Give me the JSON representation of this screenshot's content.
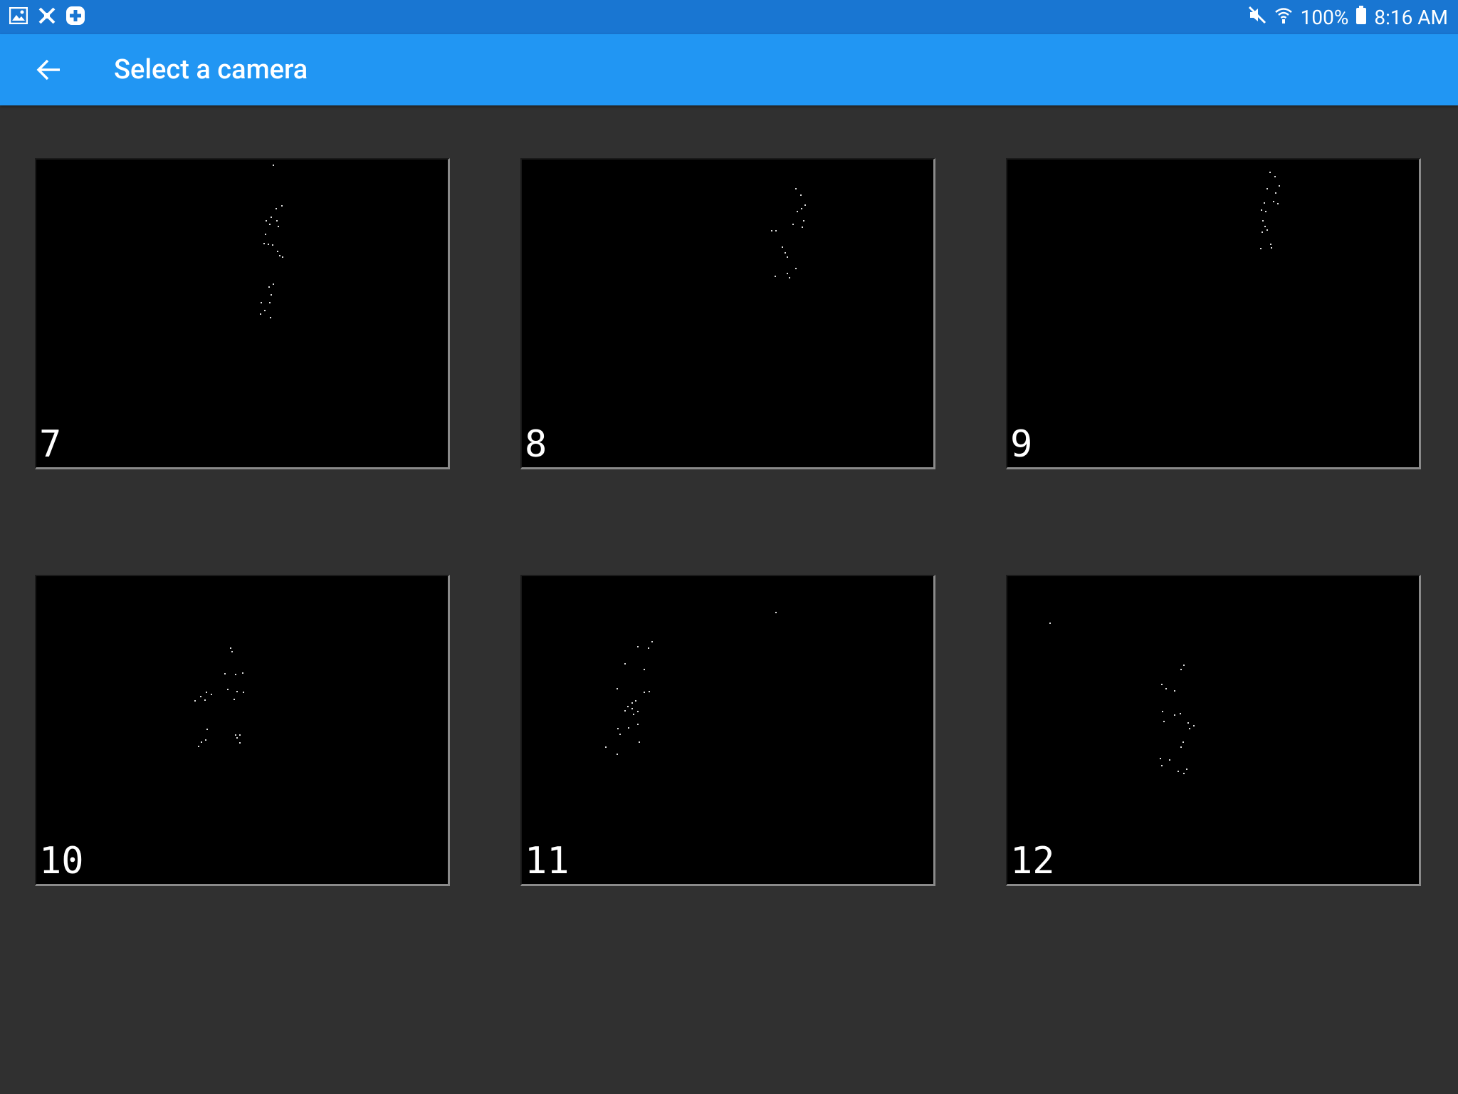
{
  "status_bar": {
    "left_icons": [
      "image-icon",
      "puzzle-x-icon",
      "medical-plus-icon"
    ],
    "mute_icon": "volume-mute-icon",
    "wifi_icon": "wifi-icon",
    "battery_percent": "100%",
    "battery_icon": "battery-full-icon",
    "time": "8:16 AM"
  },
  "app_bar": {
    "back_icon": "arrow-left-icon",
    "title": "Select a camera"
  },
  "colors": {
    "status_bar": "#1976d2",
    "app_bar": "#2196f3",
    "background": "#303030",
    "tile_background": "#000000"
  },
  "cameras": [
    {
      "label": "7"
    },
    {
      "label": "8"
    },
    {
      "label": "9"
    },
    {
      "label": "10"
    },
    {
      "label": "11"
    },
    {
      "label": "12"
    }
  ]
}
